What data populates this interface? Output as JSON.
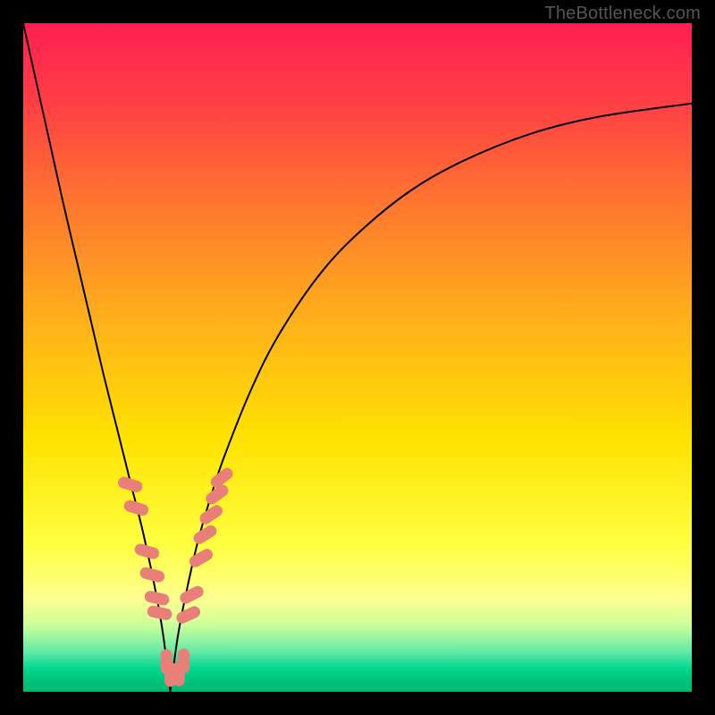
{
  "watermark": "TheBottleneck.com",
  "chart_data": {
    "type": "line",
    "title": "",
    "xlabel": "",
    "ylabel": "",
    "xlim": [
      0,
      100
    ],
    "ylim": [
      0,
      100
    ],
    "gradient_stops": [
      {
        "offset": 0,
        "color": "#ff1f52"
      },
      {
        "offset": 0.12,
        "color": "#ff3f44"
      },
      {
        "offset": 0.28,
        "color": "#ff7a2e"
      },
      {
        "offset": 0.45,
        "color": "#ffb21a"
      },
      {
        "offset": 0.62,
        "color": "#ffe200"
      },
      {
        "offset": 0.78,
        "color": "#ffff40"
      },
      {
        "offset": 0.86,
        "color": "#ffff90"
      },
      {
        "offset": 0.9,
        "color": "#ccff99"
      },
      {
        "offset": 0.94,
        "color": "#66e8a8"
      },
      {
        "offset": 0.965,
        "color": "#00d98e"
      },
      {
        "offset": 0.985,
        "color": "#00c27a"
      },
      {
        "offset": 1.0,
        "color": "#00b86f"
      }
    ],
    "series": [
      {
        "name": "bottleneck-curve",
        "notch_x": 22,
        "x": [
          0,
          2,
          4,
          6,
          8,
          10,
          12,
          14,
          16,
          18,
          20,
          21,
          22,
          23,
          24,
          26,
          28,
          30,
          34,
          38,
          44,
          50,
          58,
          66,
          76,
          86,
          100
        ],
        "y": [
          100,
          91,
          82,
          73,
          64.5,
          56,
          47.5,
          39.5,
          31.5,
          23.5,
          14,
          8,
          0,
          7.5,
          13,
          22,
          29,
          35,
          45,
          53,
          62,
          68.5,
          75,
          79.5,
          83.5,
          86,
          88
        ]
      }
    ],
    "markers": {
      "name": "highlight-dashes",
      "color": "#e88079",
      "points": [
        {
          "x": 16.0,
          "y": 31.0,
          "angle": -73
        },
        {
          "x": 16.9,
          "y": 27.5,
          "angle": -73
        },
        {
          "x": 18.5,
          "y": 21.0,
          "angle": -74
        },
        {
          "x": 19.3,
          "y": 17.5,
          "angle": -75
        },
        {
          "x": 20.0,
          "y": 14.0,
          "angle": -77
        },
        {
          "x": 20.4,
          "y": 11.8,
          "angle": -78
        },
        {
          "x": 21.4,
          "y": 4.5,
          "angle": 0
        },
        {
          "x": 22.0,
          "y": 2.6,
          "angle": 0
        },
        {
          "x": 23.3,
          "y": 2.7,
          "angle": 0
        },
        {
          "x": 24.0,
          "y": 4.6,
          "angle": 0
        },
        {
          "x": 24.7,
          "y": 11.5,
          "angle": 65
        },
        {
          "x": 25.2,
          "y": 14.5,
          "angle": 63
        },
        {
          "x": 26.6,
          "y": 20.0,
          "angle": 60
        },
        {
          "x": 27.2,
          "y": 23.5,
          "angle": 58
        },
        {
          "x": 28.1,
          "y": 26.5,
          "angle": 56
        },
        {
          "x": 29.0,
          "y": 29.5,
          "angle": 54
        },
        {
          "x": 29.7,
          "y": 32.0,
          "angle": 52
        }
      ]
    }
  }
}
